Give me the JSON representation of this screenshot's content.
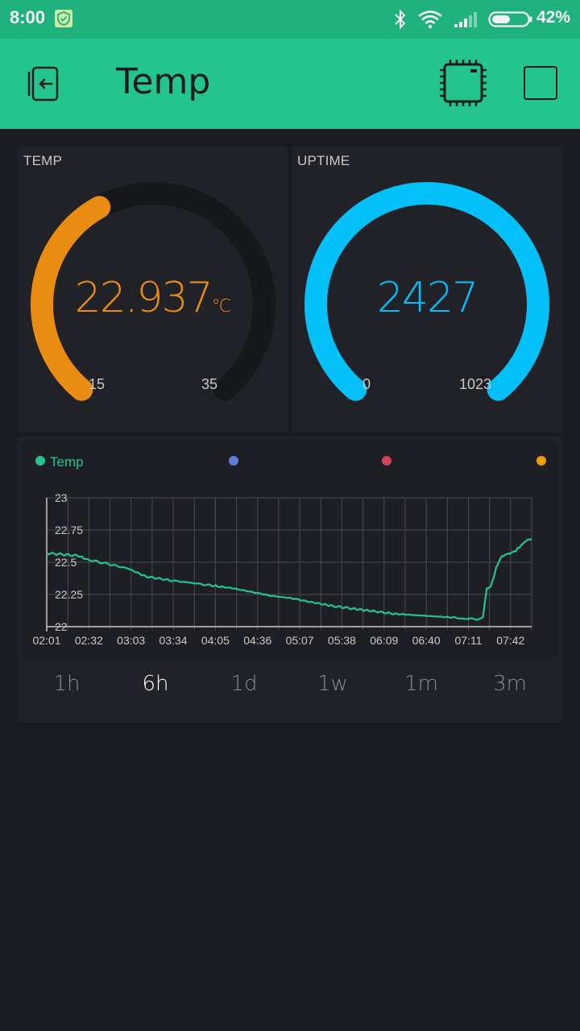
{
  "status_bar": {
    "time": "8:00",
    "battery_percent": "42%",
    "icons": [
      "shield-check-icon",
      "bluetooth-icon",
      "wifi-icon",
      "cellular-signal-icon",
      "battery-icon"
    ]
  },
  "app_bar": {
    "title": "Temp",
    "icons": [
      "exit-icon",
      "device-chip-icon",
      "stop-icon"
    ]
  },
  "temp_gauge": {
    "label": "TEMP",
    "value": "22.937",
    "unit": "℃",
    "min": "15",
    "max": "35",
    "value_number": 22.937,
    "min_number": 15,
    "max_number": 35,
    "color": "#eb8c12"
  },
  "uptime_gauge": {
    "label": "UPTIME",
    "value": "2427",
    "unit": "",
    "min": "0",
    "max": "1023",
    "value_number": 2427,
    "min_number": 0,
    "max_number": 1023,
    "color": "#04c0f8"
  },
  "chart_data": {
    "type": "line",
    "legend": [
      {
        "name": "Temp",
        "color": "#23c48e"
      },
      {
        "name": "",
        "color": "#5f7cd8"
      },
      {
        "name": "",
        "color": "#d3435c"
      },
      {
        "name": "",
        "color": "#ed9d00"
      }
    ],
    "x_tick_labels": [
      "02:01",
      "02:32",
      "03:03",
      "03:34",
      "04:05",
      "04:36",
      "05:07",
      "05:38",
      "06:09",
      "06:40",
      "07:11",
      "07:42"
    ],
    "y_tick_labels": [
      "23",
      "22.75",
      "22.5",
      "22.25",
      "22"
    ],
    "ylim": [
      22,
      23
    ],
    "x_range_minutes": [
      0,
      368
    ],
    "series": [
      {
        "name": "Temp",
        "color": "#23c48e",
        "x_minutes": [
          0,
          12,
          24,
          31,
          45,
          62,
          75,
          93,
          110,
          124,
          140,
          155,
          170,
          186,
          201,
          217,
          232,
          248,
          263,
          279,
          294,
          310,
          318,
          326,
          331,
          334,
          337,
          341,
          344,
          348,
          352,
          356,
          360,
          364,
          368
        ],
        "values": [
          22.57,
          22.56,
          22.55,
          22.52,
          22.49,
          22.45,
          22.39,
          22.36,
          22.34,
          22.32,
          22.3,
          22.27,
          22.24,
          22.22,
          22.19,
          22.16,
          22.14,
          22.12,
          22.1,
          22.09,
          22.08,
          22.07,
          22.06,
          22.06,
          22.07,
          22.3,
          22.31,
          22.45,
          22.53,
          22.56,
          22.57,
          22.59,
          22.63,
          22.67,
          22.68
        ]
      }
    ]
  },
  "range_tabs": {
    "items": [
      "1h",
      "6h",
      "1d",
      "1w",
      "1m",
      "3m"
    ],
    "active": "6h"
  }
}
